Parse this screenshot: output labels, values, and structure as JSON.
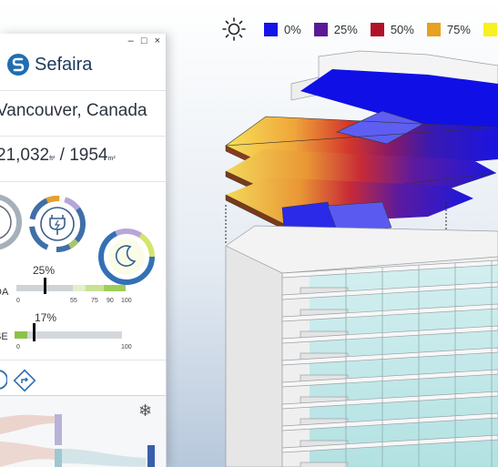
{
  "legend": {
    "sun_icon": "sun-icon",
    "items": [
      {
        "label": "0%",
        "color": "#1414e6"
      },
      {
        "label": "25%",
        "color": "#5a1a96"
      },
      {
        "label": "50%",
        "color": "#b0122a"
      },
      {
        "label": "75%",
        "color": "#e6a21e"
      },
      {
        "label": "",
        "color": "#f8f020"
      }
    ]
  },
  "panel": {
    "window_controls": {
      "minimize": "–",
      "maximize": "□",
      "close": "×"
    },
    "brand": "Sefaira",
    "location": "Vancouver, Canada",
    "area_ft_value": "21,032",
    "area_ft_unit": "ft²",
    "area_sep": " / ",
    "area_m_value": "1954",
    "area_m_unit": "m²",
    "rings": [
      {
        "icon": "gauge-icon",
        "color": "#9aa6b2"
      },
      {
        "icon": "plug-icon",
        "color": "#3f6fa8"
      },
      {
        "icon": "moon-icon",
        "color": "#2f6fae"
      }
    ],
    "metric1": {
      "label": "DA",
      "pct": "25%",
      "value": 0.25,
      "ticks": [
        "0",
        "55",
        "75",
        "90",
        "100"
      ]
    },
    "metric2": {
      "label": "SE",
      "pct": "17%",
      "value": 0.17,
      "ticks": [
        "0",
        "100"
      ]
    },
    "nav_icons": [
      "tab-icon",
      "direction-arrow-icon"
    ],
    "snowflake": "❄"
  }
}
